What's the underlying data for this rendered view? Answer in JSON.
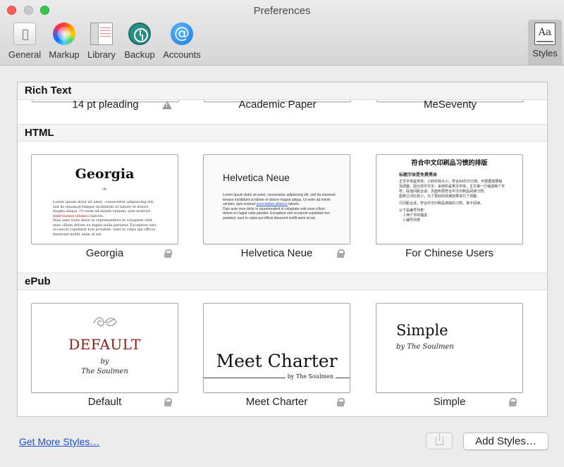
{
  "window": {
    "title": "Preferences"
  },
  "toolbar": {
    "items": [
      {
        "label": "General",
        "icon": "general-icon"
      },
      {
        "label": "Markup",
        "icon": "color-wheel-icon"
      },
      {
        "label": "Library",
        "icon": "library-icon"
      },
      {
        "label": "Backup",
        "icon": "time-machine-icon"
      },
      {
        "label": "Accounts",
        "icon": "at-sign-icon"
      },
      {
        "label": "Styles",
        "icon": "styles-icon",
        "selected": true
      }
    ],
    "accounts_glyph": "@",
    "styles_glyph": "Aa"
  },
  "sections": {
    "rich_text": {
      "title": "Rich Text",
      "styles": [
        {
          "label": "14 pt pleading",
          "warning": true
        },
        {
          "label": "Academic Paper"
        },
        {
          "label": "MeSeventy"
        }
      ]
    },
    "html": {
      "title": "HTML",
      "styles": [
        {
          "label": "Georgia",
          "locked": true,
          "preview_title": "Georgia",
          "ornament": "❧"
        },
        {
          "label": "Helvetica Neue",
          "locked": true,
          "preview_title": "Helvetica Neue"
        },
        {
          "label": "For Chinese Users",
          "locked": false,
          "preview_title": "符合中文印刷品习惯的排版"
        }
      ]
    },
    "epub": {
      "title": "ePub",
      "styles": [
        {
          "label": "Default",
          "locked": true,
          "preview_title": "DEFAULT",
          "by": "by",
          "author": "The Soulmen"
        },
        {
          "label": "Meet Charter",
          "locked": true,
          "preview_title": "Meet Charter",
          "byline": "by The Soulmen"
        },
        {
          "label": "Simple",
          "locked": true,
          "preview_title": "Simple",
          "byline": "by The Soulmen"
        }
      ]
    }
  },
  "preview_text": {
    "lorem_1": "Lorem ipsum dolor sit amet, consectetur adipisicing elit, sed do eiusmod tempor incididunt ut labore et dolore magna aliqua. Ut enim ad minim veniam, quis nostrud",
    "lorem_link": "exercitation ullamco",
    "lorem_2": "laboris.",
    "lorem_3": "Duis aute irure dolor in reprehenderit in voluptate velit esse cillum dolore eu fugiat nulla pariatur. Excepteur sint occaecat cupidatat non proident, sunt in culpa qui officia deserunt mollit anim id est.",
    "chinese_heading": "标题字体是免费黑体",
    "chinese_body": "正文字体是宋体。小四字体大小，符合A4打印习惯。可根据需要稍加调整。因为非中文字，采用的是英文字体，正文第一行缩进两个字符，段落间距合适，页面布局符合中文印刷品阅读习惯。",
    "chinese_para2": "图表之间比较小，为了更好的阅读效果进行了调整。",
    "chinese_para3": "行间距合适，符合中文印刷品排版的习惯，易于阅读。",
    "chinese_list_title": "以下是编号列表：",
    "chinese_list_1": "1  两个字的缩进",
    "chinese_list_2": "2  编号列表"
  },
  "footer": {
    "link": "Get More Styles…",
    "add_button": "Add Styles…"
  }
}
